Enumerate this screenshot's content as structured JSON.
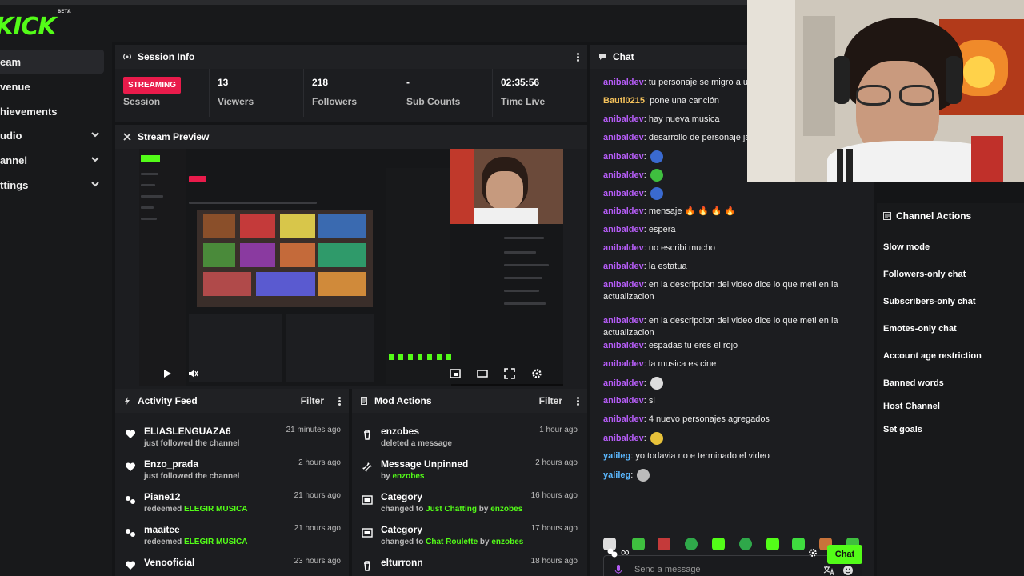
{
  "brand": {
    "logo": "KICK",
    "tag": "BETA"
  },
  "sidebar": {
    "items": [
      {
        "label": "eam"
      },
      {
        "label": "venue"
      },
      {
        "label": "hievements"
      },
      {
        "label": "udio"
      },
      {
        "label": "annel"
      },
      {
        "label": "ttings"
      }
    ]
  },
  "session_info": {
    "title": "Session Info",
    "badge": "STREAMING",
    "stats": [
      {
        "value": "",
        "label": "Session"
      },
      {
        "value": "13",
        "label": "Viewers"
      },
      {
        "value": "218",
        "label": "Followers"
      },
      {
        "value": "-",
        "label": "Sub Counts"
      },
      {
        "value": "02:35:56",
        "label": "Time Live"
      }
    ]
  },
  "stream_preview": {
    "title": "Stream Preview"
  },
  "activity_feed": {
    "title": "Activity Feed",
    "filter": "Filter",
    "rows": [
      {
        "name": "ELIASLENGUAZA6",
        "sub": "just followed the channel",
        "highlight": "",
        "time": "21 minutes ago"
      },
      {
        "name": "Enzo_prada",
        "sub": "just followed the channel",
        "highlight": "",
        "time": "2 hours ago"
      },
      {
        "name": "Piane12",
        "sub": "redeemed",
        "highlight": "ELEGIR MUSICA",
        "time": "21 hours ago"
      },
      {
        "name": "maaitee",
        "sub": "redeemed",
        "highlight": "ELEGIR MUSICA",
        "time": "21 hours ago"
      },
      {
        "name": "Venooficial",
        "sub": "",
        "highlight": "",
        "time": "23 hours ago"
      }
    ]
  },
  "mod_actions": {
    "title": "Mod Actions",
    "filter": "Filter",
    "rows": [
      {
        "name": "enzobes",
        "sub": "deleted a message",
        "time": "1 hour ago"
      },
      {
        "name": "Message Unpinned",
        "sub": "by",
        "sub_user": "enzobes",
        "time": "2 hours ago"
      },
      {
        "name": "Category",
        "sub": "changed to",
        "sub_cat": "Just Chatting",
        "sub_by": "by",
        "sub_user": "enzobes",
        "time": "16 hours ago"
      },
      {
        "name": "Category",
        "sub": "changed to",
        "sub_cat": "Chat Roulette",
        "sub_by": "by",
        "sub_user": "enzobes",
        "time": "17 hours ago"
      },
      {
        "name": "elturronn",
        "sub": "",
        "time": "18 hours ago"
      }
    ]
  },
  "chat": {
    "title": "Chat",
    "messages": [
      {
        "user": "anibaldev",
        "text": "tu personaje se migro a un"
      },
      {
        "user": "Bauti0215",
        "text": "pone una canción"
      },
      {
        "user": "anibaldev",
        "text": "hay nueva musica"
      },
      {
        "user": "anibaldev",
        "text": "desarrollo de personaje jaj"
      },
      {
        "user": "anibaldev",
        "text": ""
      },
      {
        "user": "anibaldev",
        "text": ""
      },
      {
        "user": "anibaldev",
        "text": ""
      },
      {
        "user": "anibaldev",
        "text": "mensaje"
      },
      {
        "user": "anibaldev",
        "text": "espera"
      },
      {
        "user": "anibaldev",
        "text": "no escribi mucho"
      },
      {
        "user": "anibaldev",
        "text": "la estatua"
      },
      {
        "user": "anibaldev",
        "text": "en la descripcion del video dice lo que meti en la actualizacion"
      },
      {
        "user": "anibaldev",
        "text": "en la descripcion del video dice lo que meti en la actualizacion"
      },
      {
        "user": "anibaldev",
        "text": "espadas tu eres el rojo"
      },
      {
        "user": "anibaldev",
        "text": "la musica es cine"
      },
      {
        "user": "anibaldev",
        "text": ""
      },
      {
        "user": "anibaldev",
        "text": "si"
      },
      {
        "user": "anibaldev",
        "text": "4 nuevo personajes agregados"
      },
      {
        "user": "anibaldev",
        "text": ""
      },
      {
        "user": "yalileg",
        "text": "yo todavia no e terminado el video"
      },
      {
        "user": "yalileg",
        "text": ""
      }
    ],
    "input_placeholder": "Send a message",
    "send_label": "Chat",
    "infinity": "∞"
  },
  "channel_actions": {
    "title": "Channel Actions",
    "items": [
      "Slow mode",
      "Followers-only chat",
      "Subscribers-only chat",
      "Emotes-only chat",
      "Account age restriction",
      "Banned words",
      "Host Channel",
      "Set goals"
    ]
  },
  "colors": {
    "accent": "#53fc18",
    "streaming": "#e91b4b",
    "username": "#b45cf5"
  }
}
